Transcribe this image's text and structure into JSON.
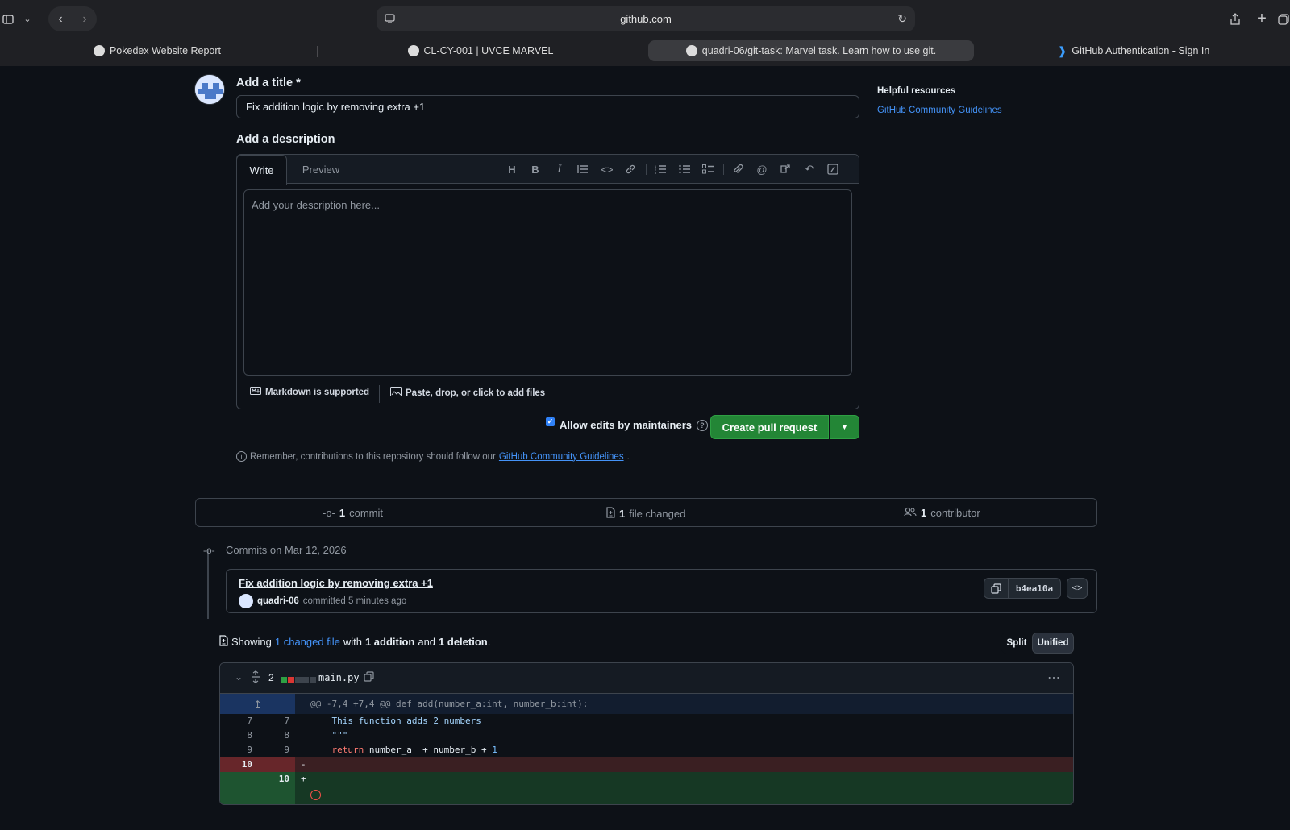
{
  "browser": {
    "url": "github.com",
    "tabs": [
      {
        "label": "Pokedex Website Report"
      },
      {
        "label": "CL-CY-001 | UVCE MARVEL"
      },
      {
        "label": "quadri-06/git-task: Marvel task. Learn how to use git."
      },
      {
        "label": "GitHub Authentication - Sign In"
      }
    ]
  },
  "form": {
    "title_label": "Add a title *",
    "title_value": "Fix addition logic by removing extra +1",
    "description_label": "Add a description",
    "tab_write": "Write",
    "tab_preview": "Preview",
    "description_placeholder": "Add your description here...",
    "markdown_note": "Markdown is supported",
    "files_note": "Paste, drop, or click to add files",
    "allow_edits": "Allow edits by maintainers",
    "create_button": "Create pull request",
    "remember_text": "Remember, contributions to this repository should follow our",
    "remember_link": "GitHub Community Guidelines",
    "remember_end": "."
  },
  "sidebar": {
    "title": "Helpful resources",
    "link": "GitHub Community Guidelines"
  },
  "stats": {
    "commits_count": "1",
    "commits_label": "commit",
    "files_count": "1",
    "files_label": "file changed",
    "contributors_count": "1",
    "contributors_label": "contributor"
  },
  "commits": {
    "date_heading": "Commits on Mar 12, 2026",
    "message": "Fix addition logic by removing extra +1",
    "author": "quadri-06",
    "committed_text": "committed 5 minutes ago",
    "sha": "b4ea10a"
  },
  "summary": {
    "showing": "Showing",
    "changed_link": "1 changed file",
    "with": "with",
    "additions": "1 addition",
    "and": "and",
    "deletions": "1 deletion",
    "end": ".",
    "split_label": "Split",
    "unified_label": "Unified"
  },
  "diff": {
    "change_count": "2",
    "filename": "main.py",
    "hunk_header": "@@ -7,4 +7,4 @@ def add(number_a:int, number_b:int):",
    "lines": [
      {
        "old": "7",
        "new": "7",
        "code": "    This function adds 2 numbers",
        "type": "context"
      },
      {
        "old": "8",
        "new": "8",
        "code": "    \"\"\"",
        "type": "context"
      },
      {
        "old": "9",
        "new": "9",
        "code_kw": "return",
        "code_rest": " number_a  + number_b + ",
        "code_num": "1",
        "type": "context"
      },
      {
        "old": "10",
        "new": "",
        "code": "-",
        "type": "deletion"
      },
      {
        "old": "",
        "new": "10",
        "code": "+",
        "type": "addition"
      }
    ]
  },
  "colors": {
    "background": "#0d1117",
    "accent_blue": "#4493f8",
    "create_green": "#238636",
    "deletion_bg": "#442628",
    "addition_bg": "#1a3b26"
  }
}
